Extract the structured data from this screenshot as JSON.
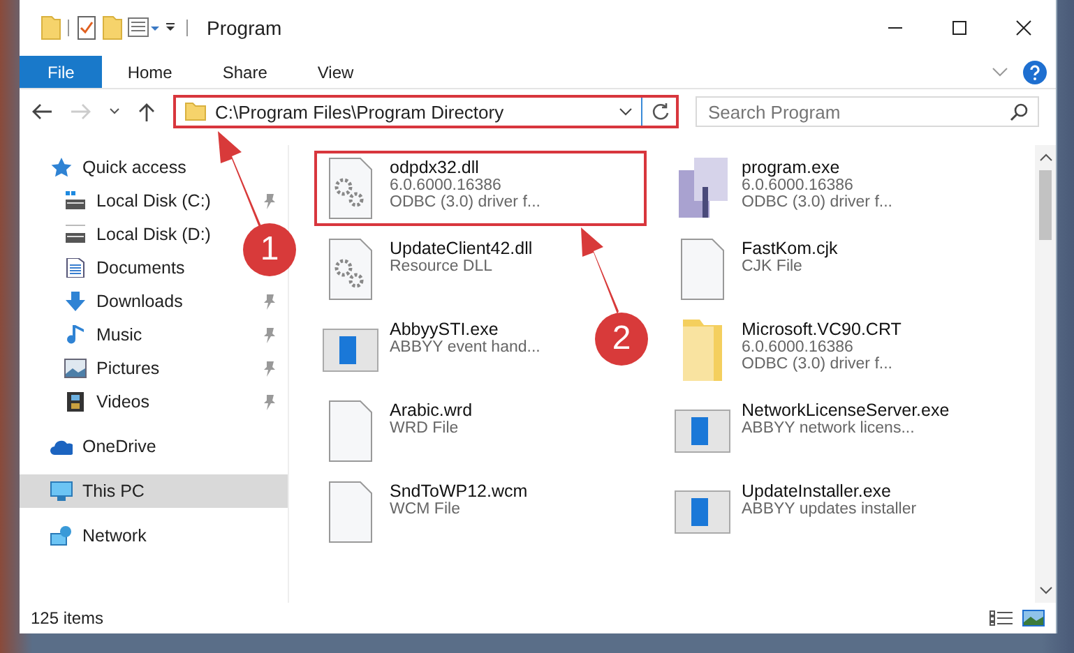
{
  "window": {
    "title": "Program"
  },
  "ribbon": {
    "tabs": [
      {
        "label": "File",
        "selected": true
      },
      {
        "label": "Home",
        "selected": false
      },
      {
        "label": "Share",
        "selected": false
      },
      {
        "label": "View",
        "selected": false
      }
    ]
  },
  "address": {
    "path": "C:\\Program Files\\Program Directory",
    "highlighted": true
  },
  "search": {
    "placeholder": "Search Program"
  },
  "sidebar": {
    "items": [
      {
        "label": "Quick access",
        "kind": "star",
        "selected": false,
        "children": [
          {
            "label": "Local Disk (C:)",
            "kind": "system-disk",
            "pinned": true,
            "selected": false
          },
          {
            "label": "Local Disk (D:)",
            "kind": "disk",
            "pinned": false,
            "selected": false
          },
          {
            "label": "Documents",
            "kind": "document",
            "pinned": false,
            "selected": false
          },
          {
            "label": "Downloads",
            "kind": "download",
            "pinned": true,
            "selected": false
          },
          {
            "label": "Music",
            "kind": "music",
            "pinned": true,
            "selected": false
          },
          {
            "label": "Pictures",
            "kind": "picture",
            "pinned": true,
            "selected": false
          },
          {
            "label": "Videos",
            "kind": "video",
            "pinned": true,
            "selected": false
          }
        ]
      },
      {
        "label": "OneDrive",
        "kind": "cloud",
        "selected": false
      },
      {
        "label": "This PC",
        "kind": "computer",
        "selected": true
      },
      {
        "label": "Network",
        "kind": "network",
        "selected": false
      }
    ]
  },
  "files": [
    {
      "name": "odpdx32.dll",
      "lines": [
        "6.0.6000.16386",
        "ODBC (3.0) driver f..."
      ],
      "kind": "dll",
      "highlighted": true
    },
    {
      "name": "program.exe",
      "lines": [
        "6.0.6000.16386",
        "ODBC (3.0) driver f..."
      ],
      "kind": "installer",
      "highlighted": false
    },
    {
      "name": "UpdateClient42.dll",
      "lines": [
        "Resource DLL"
      ],
      "kind": "dll",
      "highlighted": false
    },
    {
      "name": "FastKom.cjk",
      "lines": [
        "CJK File"
      ],
      "kind": "blank",
      "highlighted": false
    },
    {
      "name": "AbbyySTI.exe",
      "lines": [
        "ABBYY event hand..."
      ],
      "kind": "app",
      "highlighted": false
    },
    {
      "name": "Microsoft.VC90.CRT",
      "lines": [
        "6.0.6000.16386",
        "ODBC (3.0) driver f..."
      ],
      "kind": "folder",
      "highlighted": false
    },
    {
      "name": "Arabic.wrd",
      "lines": [
        "WRD File"
      ],
      "kind": "blank",
      "highlighted": false
    },
    {
      "name": "NetworkLicenseServer.exe",
      "lines": [
        "ABBYY network licens..."
      ],
      "kind": "app",
      "highlighted": false
    },
    {
      "name": "SndToWP12.wcm",
      "lines": [
        "WCM File"
      ],
      "kind": "blank",
      "highlighted": false
    },
    {
      "name": "UpdateInstaller.exe",
      "lines": [
        "ABBYY updates installer"
      ],
      "kind": "app",
      "highlighted": false
    }
  ],
  "callouts": [
    {
      "number": "1"
    },
    {
      "number": "2"
    }
  ],
  "status_bar": {
    "count": "125 items"
  }
}
